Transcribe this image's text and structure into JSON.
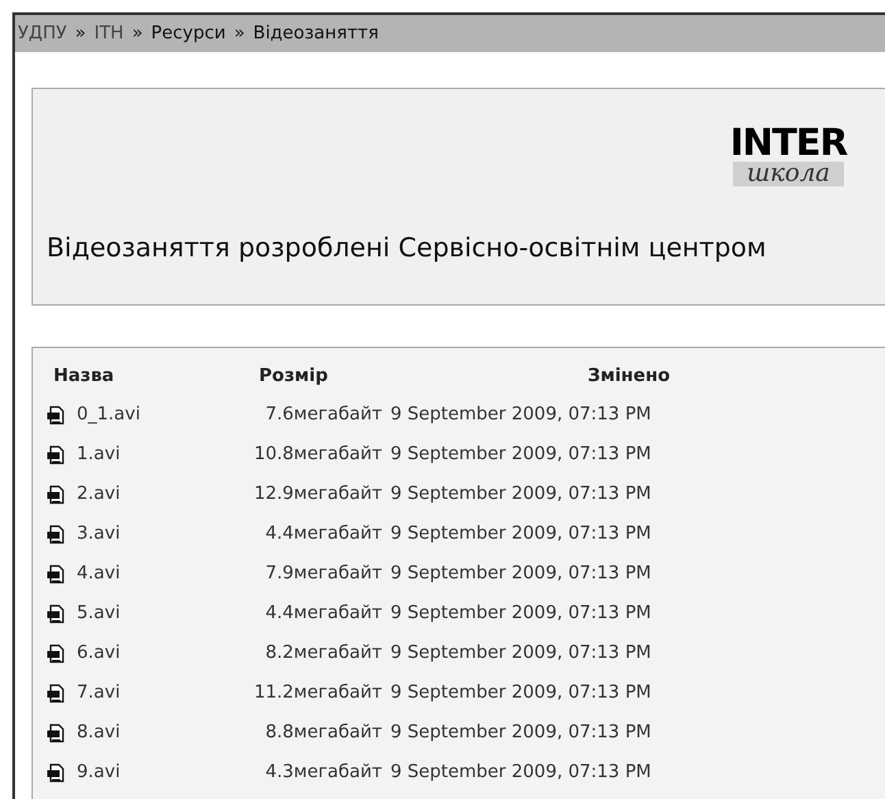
{
  "breadcrumb": {
    "separator": "»",
    "items": [
      {
        "label": "УДПУ"
      },
      {
        "label": "ІТН"
      },
      {
        "label": "Ресурси"
      },
      {
        "label": "Відеозаняття"
      }
    ]
  },
  "header": {
    "logo": {
      "top": "INTER",
      "bottom": "школа"
    },
    "caption": "Відеозаняття розроблені Сервісно-освітнім центром"
  },
  "table": {
    "columns": [
      "Назва",
      "Розмір",
      "Змінено"
    ],
    "rows": [
      {
        "name": "0_1.avi",
        "size": "7.6мегабайт",
        "modified": "9 September 2009, 07:13 PM"
      },
      {
        "name": "1.avi",
        "size": "10.8мегабайт",
        "modified": "9 September 2009, 07:13 PM"
      },
      {
        "name": "2.avi",
        "size": "12.9мегабайт",
        "modified": "9 September 2009, 07:13 PM"
      },
      {
        "name": "3.avi",
        "size": "4.4мегабайт",
        "modified": "9 September 2009, 07:13 PM"
      },
      {
        "name": "4.avi",
        "size": "7.9мегабайт",
        "modified": "9 September 2009, 07:13 PM"
      },
      {
        "name": "5.avi",
        "size": "4.4мегабайт",
        "modified": "9 September 2009, 07:13 PM"
      },
      {
        "name": "6.avi",
        "size": "8.2мегабайт",
        "modified": "9 September 2009, 07:13 PM"
      },
      {
        "name": "7.avi",
        "size": "11.2мегабайт",
        "modified": "9 September 2009, 07:13 PM"
      },
      {
        "name": "8.avi",
        "size": "8.8мегабайт",
        "modified": "9 September 2009, 07:13 PM"
      },
      {
        "name": "9.avi",
        "size": "4.3мегабайт",
        "modified": "9 September 2009, 07:13 PM"
      }
    ]
  }
}
